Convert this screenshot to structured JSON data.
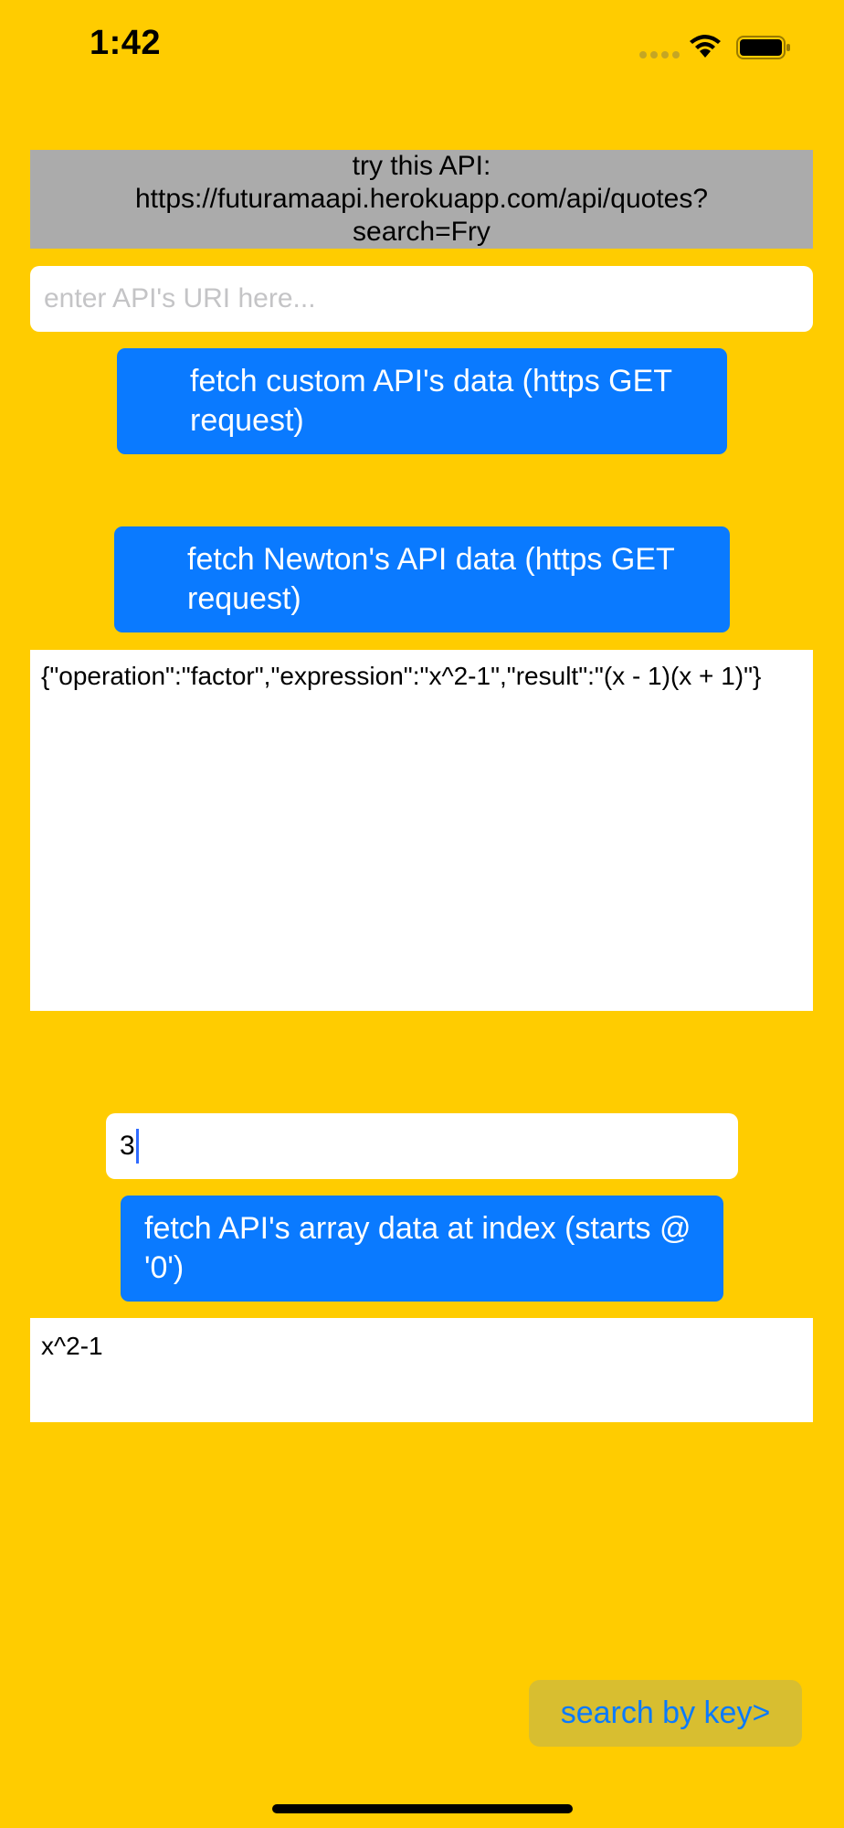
{
  "status_bar": {
    "time": "1:42",
    "icons": [
      "signal-dots-icon",
      "wifi-icon",
      "battery-icon"
    ]
  },
  "hint": {
    "text": "try this API:  https://futuramaapi.herokuapp.com/api/quotes?search=Fry"
  },
  "uri_input": {
    "placeholder": "enter API's URI here...",
    "value": ""
  },
  "buttons": {
    "fetch_custom": "fetch custom API's data (https GET request)",
    "fetch_newton": "fetch Newton's API data (https GET request)",
    "fetch_array": "fetch API's array data at index (starts @ '0')",
    "search_by_key": "search by key>"
  },
  "json_output": {
    "text": "{\"operation\":\"factor\",\"expression\":\"x^2-1\",\"result\":\"(x - 1)(x + 1)\"}"
  },
  "index_input": {
    "value": "3"
  },
  "value_output": {
    "text": "x^2-1"
  },
  "colors": {
    "background": "#FFCC00",
    "button_blue": "#0A7AFF",
    "hint_gray": "#ABABAB",
    "search_button_bg": "#D8BE30"
  }
}
